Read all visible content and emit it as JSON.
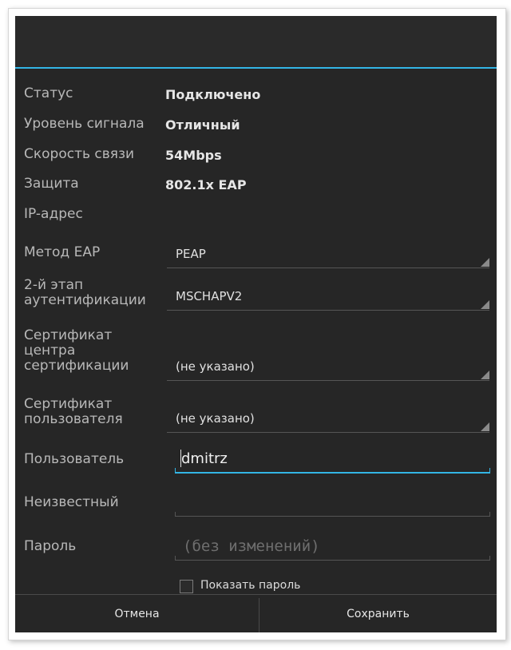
{
  "info": {
    "status": {
      "label": "Статус",
      "value": "Подключено"
    },
    "signal": {
      "label": "Уровень сигнала",
      "value": "Отличный"
    },
    "speed": {
      "label": "Скорость связи",
      "value": "54Mbps"
    },
    "security": {
      "label": "Защита",
      "value": "802.1x EAP"
    },
    "ip": {
      "label": "IP-адрес",
      "value": ""
    }
  },
  "spinners": {
    "eap_method": {
      "label": "Метод EAP",
      "value": "PEAP"
    },
    "phase2": {
      "label": "2-й этап аутентификации",
      "value": "MSCHAPV2"
    },
    "ca_cert": {
      "label": "Сертификат центра сертификации",
      "value": "(не указано)"
    },
    "user_cert": {
      "label": "Сертификат пользователя",
      "value": "(не указано)"
    }
  },
  "fields": {
    "identity": {
      "label": "Пользователь",
      "value": "dmitrz"
    },
    "anonymous": {
      "label": "Неизвестный",
      "value": ""
    },
    "password": {
      "label": "Пароль",
      "placeholder": "(без изменений)"
    }
  },
  "show_password": {
    "label": "Показать пароль",
    "checked": false
  },
  "buttons": {
    "cancel": "Отмена",
    "save": "Сохранить"
  },
  "colors": {
    "accent": "#33b5e5",
    "background": "#262626"
  }
}
